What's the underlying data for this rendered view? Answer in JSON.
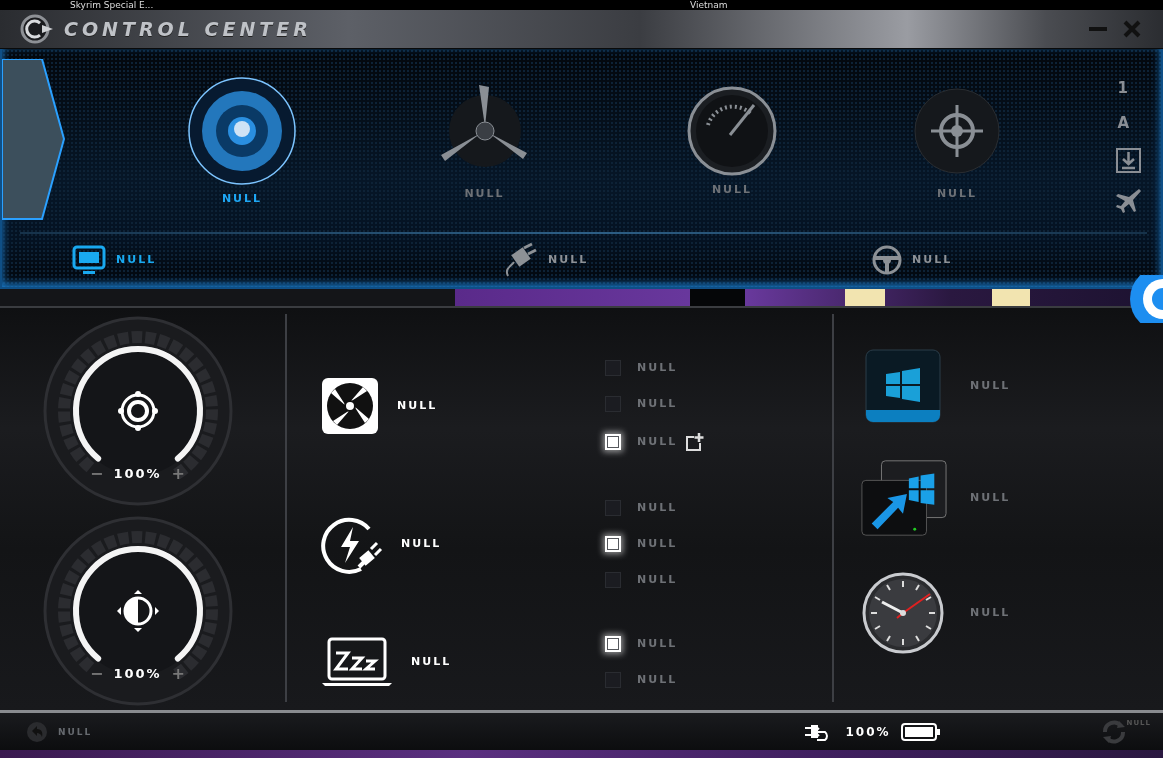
{
  "desktop": {
    "labels": [
      "Skyrim Special E...",
      "Vietnam"
    ]
  },
  "window": {
    "title": "CONTROL CENTER"
  },
  "modes": [
    {
      "kind": "speaker",
      "label": "NULL",
      "selected": true
    },
    {
      "kind": "fan",
      "label": "NULL",
      "selected": false
    },
    {
      "kind": "gauge",
      "label": "NULL",
      "selected": false
    },
    {
      "kind": "crosshair",
      "label": "NULL",
      "selected": false
    }
  ],
  "side_buttons": [
    {
      "kind": "text",
      "label": "1"
    },
    {
      "kind": "text",
      "label": "A"
    },
    {
      "kind": "download"
    },
    {
      "kind": "airplane"
    }
  ],
  "sub_tabs": [
    {
      "kind": "monitor",
      "label": "NULL",
      "selected": true
    },
    {
      "kind": "plug",
      "label": "NULL",
      "selected": false
    },
    {
      "kind": "wheel",
      "label": "NULL",
      "selected": false
    }
  ],
  "dials": [
    {
      "kind": "volume",
      "level": 1,
      "minus": "−",
      "reading": "100%",
      "plus": "+"
    },
    {
      "kind": "brightness",
      "level": 1,
      "minus": "−",
      "reading": "100%",
      "plus": "+"
    }
  ],
  "option_groups": [
    {
      "kind": "fan",
      "label": "NULL",
      "options": [
        {
          "label": "NULL",
          "checked": false
        },
        {
          "label": "NULL",
          "checked": false
        },
        {
          "label": "NULL",
          "checked": true,
          "add_icon": true
        }
      ]
    },
    {
      "kind": "power",
      "label": "NULL",
      "options": [
        {
          "label": "NULL",
          "checked": false
        },
        {
          "label": "NULL",
          "checked": true
        },
        {
          "label": "NULL",
          "checked": false
        }
      ]
    },
    {
      "kind": "sleep",
      "label": "NULL",
      "options": [
        {
          "label": "NULL",
          "checked": true
        },
        {
          "label": "NULL",
          "checked": false
        }
      ]
    }
  ],
  "apps": [
    {
      "kind": "windows",
      "label": "NULL"
    },
    {
      "kind": "remote",
      "label": "NULL"
    },
    {
      "kind": "clock",
      "label": "NULL"
    }
  ],
  "status_bar": {
    "left_label": "NULL",
    "battery_reading": "100%",
    "right_label": "NULL"
  }
}
